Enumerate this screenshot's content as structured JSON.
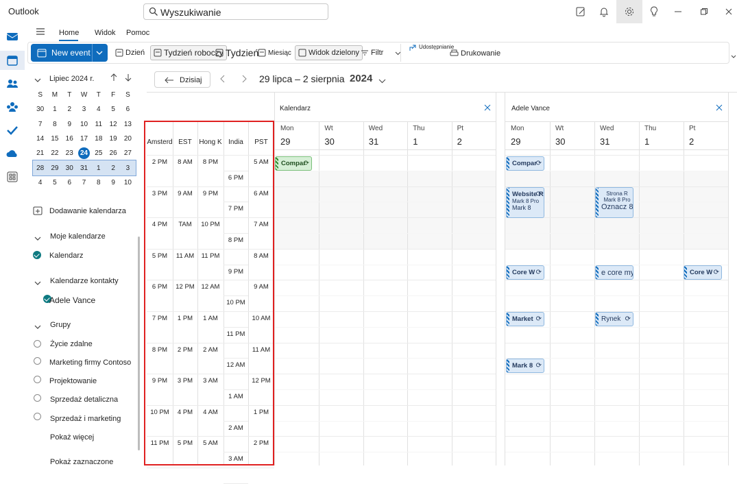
{
  "app": {
    "title": "Outlook"
  },
  "search": {
    "placeholder": "Wyszukiwanie"
  },
  "ribbon": {
    "tabs": [
      "Home",
      "Widok",
      "Pomoc"
    ],
    "new_event": "New event",
    "view_day": "Dzień",
    "view_work_week": "Tydzień roboczy",
    "view_week": "Tydzień",
    "view_month": "Miesiąc",
    "view_split": "Widok dzielony",
    "filter": "Filtr",
    "share": "Udostępnianie",
    "print": "Drukowanie"
  },
  "mini_calendar": {
    "title": "Lipiec 2024 r.",
    "weekdays": [
      "S",
      "M",
      "T",
      "W",
      "T",
      "F",
      "S"
    ],
    "weeks": [
      [
        "30",
        "1",
        "2",
        "3",
        "4",
        "5",
        "6"
      ],
      [
        "7",
        "8",
        "9",
        "10",
        "11",
        "12",
        "13"
      ],
      [
        "14",
        "15",
        "16",
        "17",
        "18",
        "19",
        "20"
      ],
      [
        "21",
        "22",
        "23",
        "24",
        "25",
        "26",
        "27"
      ],
      [
        "28",
        "29",
        "30",
        "31",
        "1",
        "2",
        "3"
      ],
      [
        "4",
        "5",
        "6",
        "7",
        "8",
        "9",
        "10"
      ]
    ],
    "today": "24"
  },
  "nav": {
    "add_calendar": "Dodawanie kalendarza",
    "my_calendars": "Moje kalendarze",
    "calendar": "Kalendarz",
    "contact_calendars": "Kalendarze kontakty",
    "adele": "Adele Vance",
    "groups": "Grupy",
    "group_items": [
      "Życie zdalne",
      "Marketing firmy Contoso",
      "Projektowanie",
      "Sprzedaż detaliczna",
      "Sprzedaż i marketing"
    ],
    "show_more": "Pokaż więcej",
    "show_selected": "Pokaż zaznaczone"
  },
  "calendar": {
    "today_btn": "Dzisiaj",
    "range": "29 lipca – 2 sierpnia",
    "year": "2024",
    "timezones": [
      "Amsterd",
      "EST",
      "Hong K",
      "India",
      "PST"
    ],
    "times": {
      "amsterdam": [
        "2 PM",
        "3 PM",
        "4 PM",
        "5 PM",
        "6 PM",
        "7 PM",
        "8 PM",
        "9 PM",
        "10 PM",
        "11 PM"
      ],
      "est": [
        "8 AM",
        "9 AM",
        "TAM",
        "11 AM",
        "12 PM",
        "1 PM",
        "2 PM",
        "3 PM",
        "4 PM",
        "5 PM"
      ],
      "hongkong": [
        "8 PM",
        "9 PM",
        "10 PM",
        "11 PM",
        "12 AM",
        "1 AM",
        "2 AM",
        "3 AM",
        "4 AM",
        "5 AM"
      ],
      "india": [
        "6 PM",
        "7 PM",
        "8 PM",
        "9 PM",
        "10 PM",
        "11 PM",
        "12 AM",
        "1 AM",
        "2 AM",
        "3 AM"
      ],
      "pst": [
        "5 AM",
        "6 AM",
        "7 AM",
        "8 AM",
        "9 AM",
        "10 AM",
        "11 AM",
        "12 PM",
        "1 PM",
        "2 PM"
      ]
    },
    "pane1": {
      "title": "Kalendarz",
      "days": [
        {
          "h": "Mon",
          "n": "29"
        },
        {
          "h": "Wt",
          "n": "30"
        },
        {
          "h": "Wed",
          "n": "31"
        },
        {
          "h": "Thu",
          "n": "1"
        },
        {
          "h": "Pt",
          "n": "2"
        }
      ]
    },
    "pane2": {
      "title": "Adele Vance",
      "days": [
        {
          "h": "Mon",
          "n": "29"
        },
        {
          "h": "Wt",
          "n": "30"
        },
        {
          "h": "Wed",
          "n": "31"
        },
        {
          "h": "Thu",
          "n": "1"
        },
        {
          "h": "Pt",
          "n": "2"
        }
      ]
    },
    "events": {
      "p1_compan": "Compar",
      "p2_compan": "Compar",
      "p2_website_title": "Website R",
      "p2_website_l2": "Mark 8 Pro",
      "p2_website_l3": "Mark 8",
      "p2_strona_title": "Strona R",
      "p2_strona_l2": "Mark 8 Pro",
      "p2_strona_l3": "Oznacz 8",
      "p2_core1": "Core W",
      "p2_core2": "e core my",
      "p2_core3": "Core W",
      "p2_market": "Market",
      "p2_rynek": "Rynek",
      "p2_mark8": "Mark 8"
    }
  }
}
